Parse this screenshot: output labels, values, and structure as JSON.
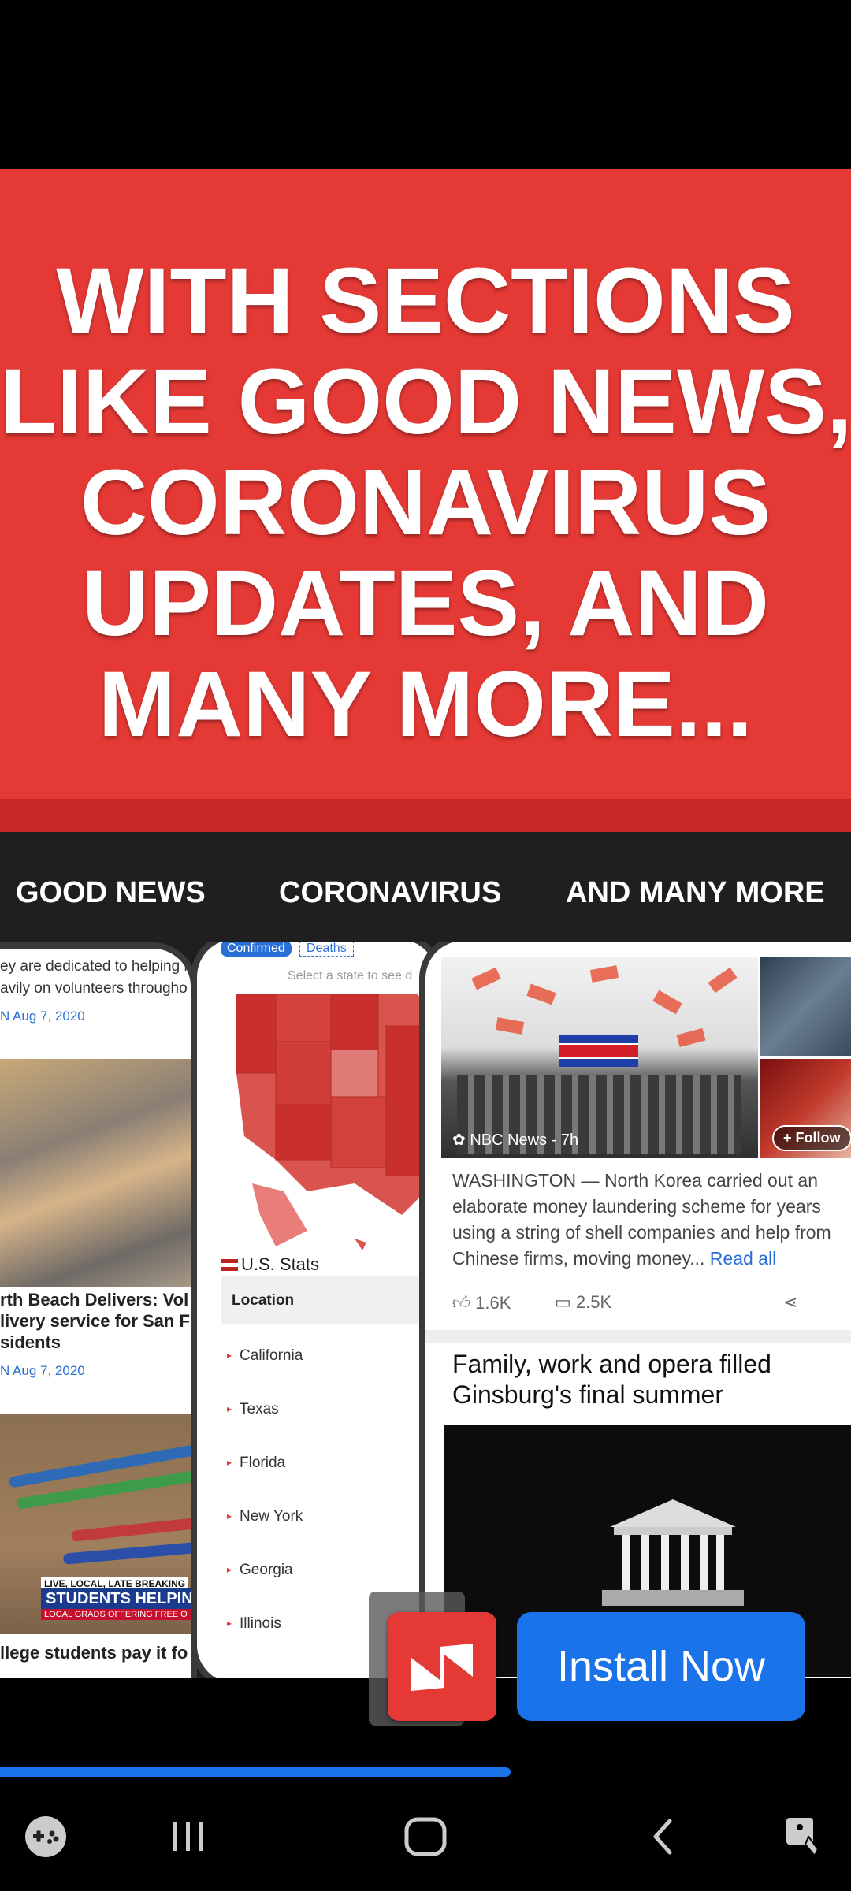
{
  "headline": {
    "lines": [
      "WITH SECTIONS",
      "LIKE GOOD NEWS,",
      "CORONAVIRUS",
      "UPDATES, AND",
      "MANY MORE..."
    ]
  },
  "categories": [
    "GOOD NEWS",
    "CORONAVIRUS",
    "AND MANY MORE"
  ],
  "left_phone": {
    "snippet1": "ey are dedicated to helping la",
    "snippet2": "avily on volunteers througho",
    "meta1": "N  Aug 7, 2020",
    "article_title_lines": [
      "rth Beach Delivers: Vol",
      "livery service for San Fr",
      "sidents"
    ],
    "meta2": "N  Aug 7, 2020",
    "banner_tag": "LIVE, LOCAL, LATE BREAKING",
    "banner_main": "STUDENTS HELPIN",
    "banner_sub": "LOCAL GRADS OFFERING FREE O",
    "bottom_snippet": "llege students pay it fo"
  },
  "middle_phone": {
    "tabs": [
      "Confirmed",
      "Deaths"
    ],
    "hint": "Select a state to see d",
    "stats_title": "U.S. Stats",
    "location_header": "Location",
    "states": [
      "California",
      "Texas",
      "Florida",
      "New York",
      "Georgia",
      "Illinois"
    ]
  },
  "right_phone": {
    "source": "NBC News - 7h",
    "follow_label": "+ Follow",
    "summary": "WASHINGTON — North Korea carried out an elaborate money laundering scheme for years using a string of shell companies and help from Chinese firms, moving money...",
    "read_all": "Read all",
    "likes": "1.6K",
    "comments": "2.5K",
    "article2_title": "Family, work and opera filled Ginsburg's final summer"
  },
  "cta": {
    "install_label": "Install Now",
    "app_icon": "newsbreak-logo-icon"
  },
  "progress": {
    "fraction": 0.6
  },
  "nav": {
    "icons": [
      "game-controller-icon",
      "recent-apps-icon",
      "home-icon",
      "back-icon",
      "accessibility-touch-icon"
    ]
  },
  "colors": {
    "banner_red": "#e53935",
    "install_blue": "#1a73e8",
    "dark_bar": "#1f1f1f"
  }
}
